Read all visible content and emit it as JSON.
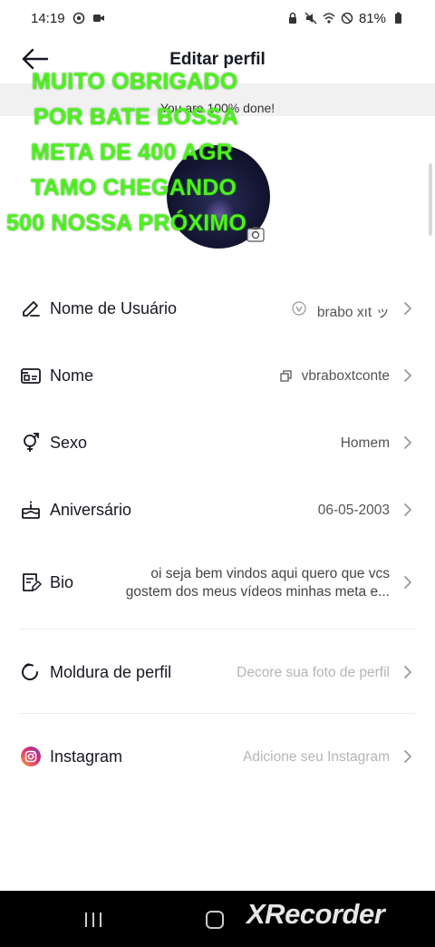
{
  "status_bar": {
    "time": "14:19",
    "battery": "81%",
    "left_icons": [
      "whatsapp-icon",
      "video-camera-icon"
    ],
    "right_icons": [
      "lock-icon",
      "mute-icon",
      "wifi-icon",
      "no-disturb-icon",
      "battery-icon"
    ]
  },
  "header": {
    "title": "Editar perfil",
    "back_icon": "arrow-left-icon"
  },
  "progress": {
    "text": "You are 100% done!"
  },
  "overlay": {
    "lines": [
      "MUITO OBRIGADO",
      "POR BATE BOSSA",
      "META DE 400 AGR",
      "TAMO CHEGANDO",
      "500 NOSSA PRÓXIMO"
    ],
    "color": "#4cf21d"
  },
  "rows": {
    "username": {
      "label": "Nome de Usuário",
      "value": "brabo xıt ッ",
      "icon": "pencil-icon"
    },
    "name": {
      "label": "Nome",
      "value": "vbraboxtconte",
      "icon": "id-card-icon"
    },
    "sex": {
      "label": "Sexo",
      "value": "Homem",
      "icon": "gender-icon"
    },
    "birthday": {
      "label": "Aniversário",
      "value": "06-05-2003",
      "icon": "cake-icon"
    },
    "bio": {
      "label": "Bio",
      "value_line1": "oi seja bem vindos aqui quero que vcs",
      "value_line2": "gostem dos meus vídeos minhas meta e...",
      "icon": "edit-document-icon"
    },
    "frame": {
      "label": "Moldura de perfil",
      "value": "Decore sua foto de perfil",
      "icon": "frame-icon"
    },
    "instagram": {
      "label": "Instagram",
      "value": "Adicione seu Instagram",
      "icon": "instagram-icon"
    }
  },
  "nav": {
    "watermark": "XRecorder"
  },
  "colors": {
    "placeholder": "#b5b5b8",
    "text": "#161823",
    "instagram": "#e1306c"
  }
}
